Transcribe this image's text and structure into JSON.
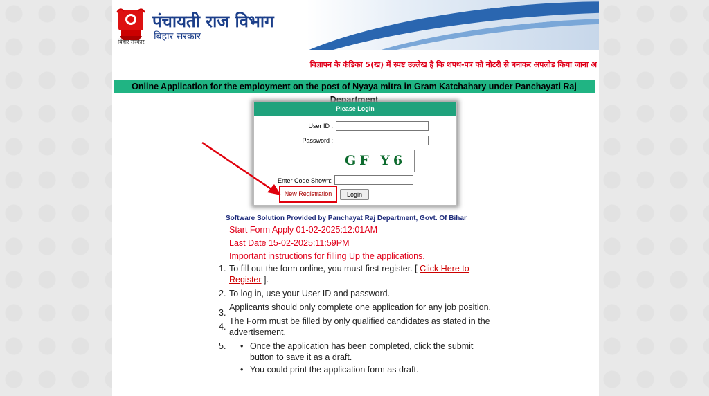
{
  "header": {
    "title": "पंचायती राज विभाग",
    "subtitle": "बिहार सरकार",
    "logo_caption": "बिहार सरकार"
  },
  "notice": "विज्ञापन के कंडिका 5(ख) में स्पष्ट उल्लेख है कि शपथ-पत्र को नोटरी से बनाकर अपलोड किया जाना अ",
  "banner": "Online Application for the employment on the post of Nyaya mitra in Gram Katchahary under Panchayati Raj Department",
  "login": {
    "title": "Please Login",
    "user_id_label": "User ID :",
    "password_label": "Password :",
    "captcha_text": "GF Y6",
    "code_label": "Enter Code Shown:",
    "new_registration": "New Registration",
    "login_button": "Login"
  },
  "provider": "Software Solution Provided by Panchayat Raj Department, Govt. Of Bihar",
  "dates": {
    "start": "Start Form Apply 01-02-2025:12:01AM",
    "last": "Last Date 15-02-2025:11:59PM",
    "instructions_title": "Important instructions for filling Up the applications."
  },
  "instructions": {
    "i1_pre": "To fill out the form online, you must first register. [ ",
    "i1_link": "Click Here to Register",
    "i1_post": " ].",
    "i2": "To log in, use your User ID and password.",
    "i3": "Applicants should only complete one application for any job position.",
    "i4": "The Form must be filled by only qualified candidates as stated in the advertisement.",
    "i5_sub1": "Once the application has been completed, click the submit button to save it as a draft.",
    "i5_sub2": "You could print the application form as draft."
  },
  "colors": {
    "banner_green": "#20b483",
    "login_header_green": "#1fa27c",
    "alert_red": "#e0001a",
    "title_blue": "#1c3f8a"
  }
}
